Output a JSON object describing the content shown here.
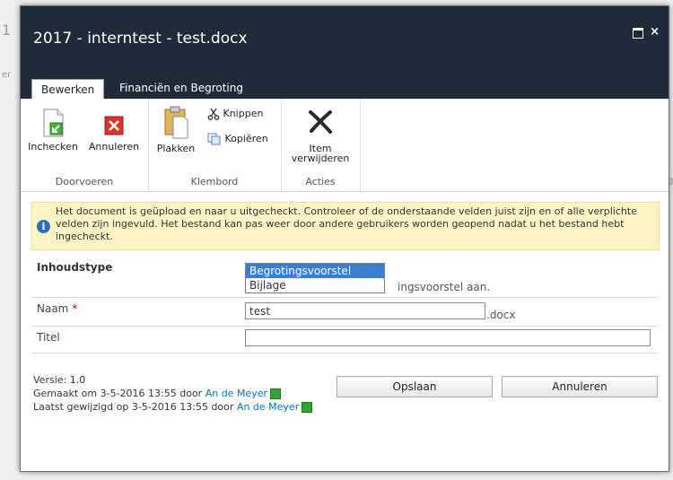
{
  "background": {
    "fragment_1": "1",
    "fragment_2": "er",
    "fragment_3": "g"
  },
  "dialog": {
    "title": "2017 - interntest - test.docx",
    "maximize_icon": "maximize-icon",
    "close_label": "×"
  },
  "ribbon": {
    "tabs": [
      {
        "label": "Bewerken",
        "active": true
      },
      {
        "label": "Financiën en Begroting",
        "active": false
      }
    ],
    "groups": {
      "doorvoeren": {
        "label": "Doorvoeren",
        "checkin": "Inchecken",
        "discard": "Annuleren"
      },
      "klembord": {
        "label": "Klembord",
        "paste": "Plakken",
        "cut": "Knippen",
        "copy": "Kopiëren"
      },
      "acties": {
        "label": "Acties",
        "delete_line1": "Item",
        "delete_line2": "verwijderen"
      }
    }
  },
  "info_message": "Het document is geüpload en naar u uitgecheckt. Controleer of de onderstaande velden juist zijn en of alle verplichte velden zijn ingevuld. Het bestand kan pas weer door andere gebruikers worden geopend nadat u het bestand hebt ingecheckt.",
  "form": {
    "content_type": {
      "label": "Inhoudstype",
      "options": [
        "Begrotingsvoorstel",
        "Bijlage"
      ],
      "selected": "Begrotingsvoorstel",
      "description_visible": "ingsvoorstel aan."
    },
    "name": {
      "label": "Naam",
      "required_marker": "*",
      "value": "test",
      "suffix": ".docx"
    },
    "title": {
      "label": "Titel",
      "value": ""
    }
  },
  "footer": {
    "version": "Versie: 1.0",
    "created_prefix": "Gemaakt om 3-5-2016 13:55 door",
    "created_by": "An de Meyer",
    "modified_prefix": "Laatst gewijzigd op 3-5-2016 13:55 door",
    "modified_by": "An de Meyer"
  },
  "buttons": {
    "save": "Opslaan",
    "cancel": "Annuleren"
  },
  "colors": {
    "titlebar": "#202b3a",
    "info_background": "#fdf4c5",
    "link": "#0072c6",
    "selection": "#3c7fcf",
    "presence": "#33a532"
  }
}
